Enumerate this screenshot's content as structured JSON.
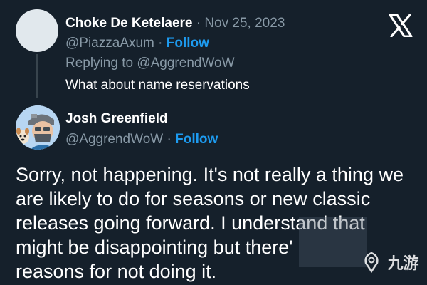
{
  "parent_tweet": {
    "name": "Choke De Ketelaere",
    "separator": " · ",
    "date": "Nov 25, 2023",
    "handle": "@PiazzaAxum",
    "follow_separator": " · ",
    "follow_label": "Follow",
    "replying_to": "Replying to @AggrendWoW",
    "text": "What about name reservations"
  },
  "reply_tweet": {
    "name": "Josh Greenfield",
    "handle": "@AggrendWoW",
    "follow_separator": " · ",
    "follow_label": "Follow",
    "text_lines": [
      "Sorry, not happening.  It's not really a thing we",
      "are likely to do for seasons or new classic",
      "releases going forward.  I understand that",
      "might be disappointing but there'",
      "reasons for not doing it."
    ]
  },
  "watermark": {
    "text": "九游"
  },
  "icons": {
    "brand": "x-logo-icon",
    "watermark": "watermark-logo-icon"
  },
  "colors": {
    "background": "#15202b",
    "text": "#ffffff",
    "muted": "#8899a6",
    "accent": "#1d9bf0",
    "thread_line": "#38444d"
  }
}
